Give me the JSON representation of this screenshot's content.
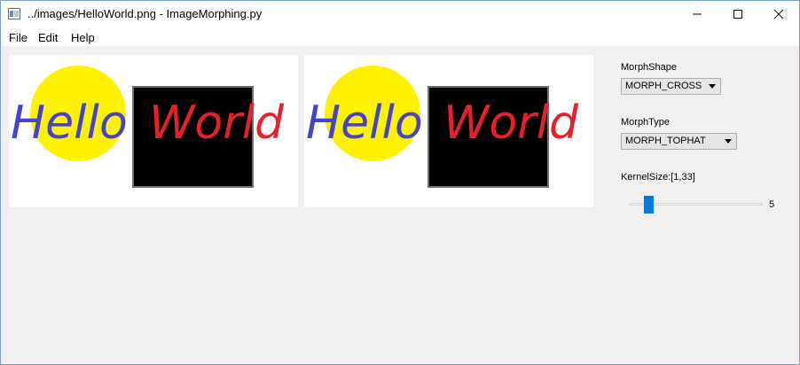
{
  "window": {
    "title": "../images/HelloWorld.png - ImageMorphing.py"
  },
  "menu": {
    "items": [
      "File",
      "Edit",
      "Help"
    ]
  },
  "images": {
    "source": {
      "word1": "Hello",
      "word2": "World"
    },
    "result": {
      "word1": "Hello",
      "word2": "World"
    }
  },
  "controls": {
    "morph_shape": {
      "label": "MorphShape",
      "value": "MORPH_CROSS"
    },
    "morph_type": {
      "label": "MorphType",
      "value": "MORPH_TOPHAT"
    },
    "kernel": {
      "label": "KernelSize:[1,33]",
      "value": "5",
      "min": 1,
      "max": 33
    }
  },
  "colors": {
    "hello": "#4444cc",
    "world": "#e8202a",
    "circle": "#fff200",
    "square": "#000000",
    "accent": "#007ad9"
  }
}
